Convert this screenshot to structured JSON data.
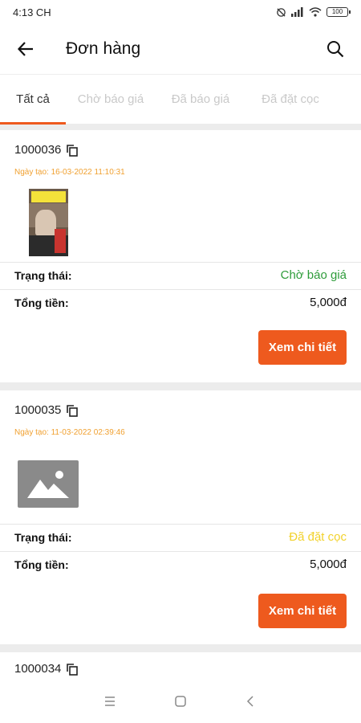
{
  "status_bar": {
    "time": "4:13 CH",
    "battery": "100"
  },
  "header": {
    "title": "Đơn hàng"
  },
  "tabs": [
    {
      "label": "Tất cả"
    },
    {
      "label": "Chờ báo giá"
    },
    {
      "label": "Đã báo giá"
    },
    {
      "label": "Đã đặt cọc"
    }
  ],
  "orders": [
    {
      "id": "1000036",
      "created": "Ngày tạo: 16-03-2022 11:10:31",
      "status_label": "Trạng thái:",
      "status": "Chờ báo giá",
      "total_label": "Tổng tiền:",
      "total": "5,000đ",
      "button": "Xem chi tiết"
    },
    {
      "id": "1000035",
      "created": "Ngày tạo: 11-03-2022 02:39:46",
      "status_label": "Trạng thái:",
      "status": "Đã đặt cọc",
      "total_label": "Tổng tiền:",
      "total": "5,000đ",
      "button": "Xem chi tiết"
    },
    {
      "id": "1000034"
    }
  ],
  "colors": {
    "accent": "#ee5a1e",
    "status_pending": "#2e9c3a",
    "status_deposit": "#f2d22c",
    "date": "#f0a030"
  },
  "icons": {
    "back": "arrow-left-icon",
    "search": "search-icon",
    "copy": "copy-icon",
    "placeholder": "image-placeholder-icon"
  }
}
